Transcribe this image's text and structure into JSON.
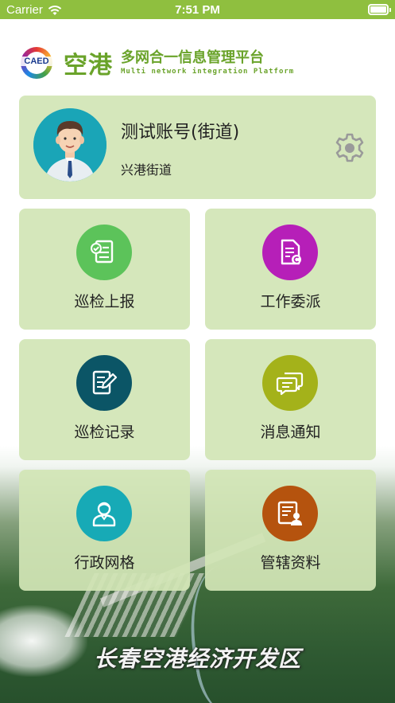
{
  "status_bar": {
    "carrier": "Carrier",
    "time": "7:51 PM"
  },
  "header": {
    "logo_text": "CAED",
    "brand_big": "空港",
    "brand_cn": "多网合一信息管理平台",
    "brand_en": "Multi network integration Platform"
  },
  "profile": {
    "name": "测试账号(街道)",
    "street": "兴港街道"
  },
  "menu": [
    {
      "label": "巡检上报",
      "color": "#5cc35a",
      "icon": "checklist-icon"
    },
    {
      "label": "工作委派",
      "color": "#b61fb8",
      "icon": "document-copyright-icon"
    },
    {
      "label": "巡检记录",
      "color": "#0b5566",
      "icon": "document-edit-icon"
    },
    {
      "label": "消息通知",
      "color": "#a4b21a",
      "icon": "chat-bubbles-icon"
    },
    {
      "label": "行政网格",
      "color": "#17aab6",
      "icon": "user-icon"
    },
    {
      "label": "管辖资料",
      "color": "#b5530e",
      "icon": "profile-document-icon"
    }
  ],
  "footer": {
    "zone_title": "长春空港经济开发区"
  }
}
